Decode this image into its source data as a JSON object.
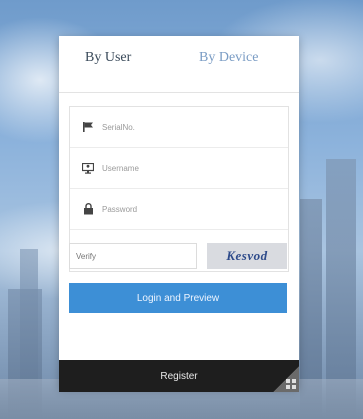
{
  "tabs": {
    "by_user": "By User",
    "by_device": "By Device"
  },
  "fields": {
    "serial_placeholder": "SerialNo.",
    "username_placeholder": "Username",
    "password_placeholder": "Password"
  },
  "captcha": {
    "input_placeholder": "Verify",
    "image_text": "Kesvod"
  },
  "buttons": {
    "login": "Login and Preview",
    "register": "Register"
  },
  "colors": {
    "accent": "#3d8fd6",
    "register_bg": "#1e1e1e",
    "inactive_tab": "#7a9cc4"
  },
  "icons": {
    "serial": "flag-icon",
    "username": "monitor-user-icon",
    "password": "lock-icon",
    "corner": "grid-icon"
  }
}
